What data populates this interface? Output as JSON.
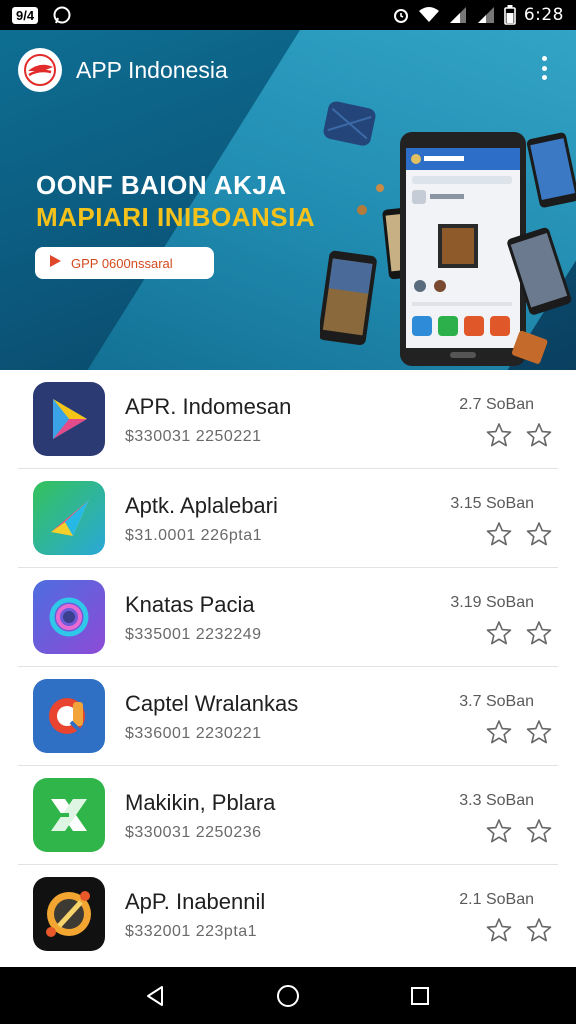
{
  "status_bar": {
    "left_badge": "9/4",
    "time": "6:28",
    "icons": [
      "whatsapp-icon",
      "alarm-icon",
      "wifi-icon",
      "signal-icon",
      "signal-icon",
      "battery-icon"
    ]
  },
  "header": {
    "title": "APP Indonesia",
    "logo_icon": "brand-logo-icon",
    "menu_icon": "more-vert-icon"
  },
  "hero": {
    "line1": "OONF BAION AKJA",
    "line2": "MAPIARI INIBOANSIA",
    "cta_label": "GPP 0600nssaral",
    "colors": {
      "line2": "#f4c21b",
      "cta_text": "#d34a1d"
    }
  },
  "apps": [
    {
      "name": "APR. Indomesan",
      "meta": "$330031 2250221",
      "rating": "2.7 SoBan",
      "icon": "play-triangle-icon"
    },
    {
      "name": "Aptk. Aplalebari",
      "meta": "$31.0001 226pta1",
      "rating": "3.15 SoBan",
      "icon": "paper-plane-icon"
    },
    {
      "name": "Knatas Pacia",
      "meta": "$335001 2232249",
      "rating": "3.19 SoBan",
      "icon": "ring-icon"
    },
    {
      "name": "Captel Wralankas",
      "meta": "$336001 2230221",
      "rating": "3.7 SoBan",
      "icon": "search-q-icon"
    },
    {
      "name": "Makikin, Pblara",
      "meta": "$330031 2250236",
      "rating": "3.3 SoBan",
      "icon": "x-mark-icon"
    },
    {
      "name": "ApP. Inabennil",
      "meta": "$332001 223pta1",
      "rating": "2.1 SoBan",
      "icon": "compass-icon"
    }
  ],
  "nav": {
    "back_icon": "back-triangle-icon",
    "home_icon": "home-circle-icon",
    "recents_icon": "recents-square-icon"
  }
}
